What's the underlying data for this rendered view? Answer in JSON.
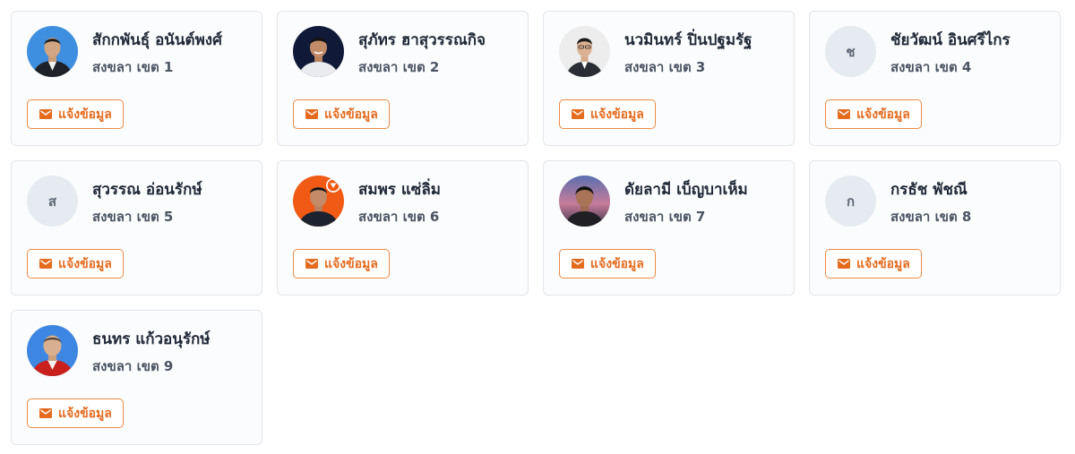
{
  "accent_color": "#e56b1f",
  "cards": [
    {
      "name": "สักกพันธุ์ อนันต์พงศ์",
      "district": "สงขลา เขต 1",
      "avatar": {
        "type": "photo",
        "photo": "man-suit-blue-bg"
      },
      "button_label": "แจ้งข้อมูล"
    },
    {
      "name": "สุภัทร ฮาสุวรรณกิจ",
      "district": "สงขลา เขต 2",
      "avatar": {
        "type": "photo",
        "photo": "man-dark-bg"
      },
      "button_label": "แจ้งข้อมูล"
    },
    {
      "name": "นวมินทร์ ปิ่นปฐมรัฐ",
      "district": "สงขลา เขต 3",
      "avatar": {
        "type": "photo",
        "photo": "man-suit-white-bg"
      },
      "button_label": "แจ้งข้อมูล"
    },
    {
      "name": "ชัยวัฒน์ อินศรีไกร",
      "district": "สงขลา เขต 4",
      "avatar": {
        "type": "initial",
        "initial": "ช"
      },
      "button_label": "แจ้งข้อมูล"
    },
    {
      "name": "สุวรรณ อ่อนรักษ์",
      "district": "สงขลา เขต 5",
      "avatar": {
        "type": "initial",
        "initial": "ส"
      },
      "button_label": "แจ้งข้อมูล"
    },
    {
      "name": "สมพร แซ่ลิ่ม",
      "district": "สงขลา เขต 6",
      "avatar": {
        "type": "photo",
        "photo": "man-orange-bg-party-badge"
      },
      "button_label": "แจ้งข้อมูล"
    },
    {
      "name": "ดัยลามี เบ็ญบาเห็ม",
      "district": "สงขลา เขต 7",
      "avatar": {
        "type": "photo",
        "photo": "man-sunset-bg"
      },
      "button_label": "แจ้งข้อมูล"
    },
    {
      "name": "กรธัช พัชณี",
      "district": "สงขลา เขต 8",
      "avatar": {
        "type": "initial",
        "initial": "ก"
      },
      "button_label": "แจ้งข้อมูล"
    },
    {
      "name": "ธนทร แก้วอนุรักษ์",
      "district": "สงขลา เขต 9",
      "avatar": {
        "type": "photo",
        "photo": "man-red-robe-blue-bg"
      },
      "button_label": "แจ้งข้อมูล"
    }
  ]
}
